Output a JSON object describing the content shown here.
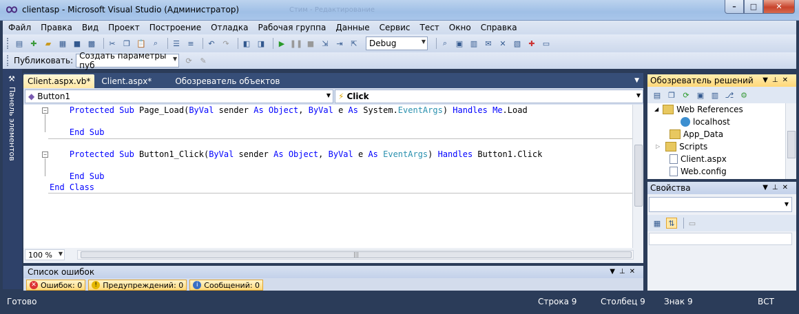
{
  "window": {
    "title": "clientasp - Microsoft Visual Studio (Администратор)",
    "ghost_title": "Стим - Редактирование",
    "min": "–",
    "max": "□",
    "close": "✕"
  },
  "menu": [
    "Файл",
    "Правка",
    "Вид",
    "Проект",
    "Построение",
    "Отладка",
    "Рабочая группа",
    "Данные",
    "Сервис",
    "Тест",
    "Окно",
    "Справка"
  ],
  "toolbar": {
    "config": "Debug",
    "publish_label": "Публиковать:",
    "publish_value": "Создать параметры пуб"
  },
  "left_strip": {
    "label": "Панель элементов"
  },
  "tabs": [
    {
      "label": "Client.aspx.vb*",
      "active": true
    },
    {
      "label": "Client.aspx*",
      "active": false
    },
    {
      "label": "Обозреватель объектов",
      "active": false
    }
  ],
  "nav": {
    "object": "Button1",
    "member": "Click"
  },
  "code": {
    "line1": {
      "pre": "    ",
      "k1": "Protected Sub",
      "n1": " Page_Load(",
      "k2": "ByVal",
      "n2": " sender ",
      "k3": "As",
      "n3": " ",
      "k4": "Object",
      "n4": ", ",
      "k5": "ByVal",
      "n5": " e ",
      "k6": "As",
      "n6": " System.",
      "t1": "EventArgs",
      "n7": ") ",
      "k7": "Handles",
      "n8": " ",
      "k8": "Me",
      "n9": ".Load"
    },
    "line2": "    End Sub",
    "line3": {
      "pre": "    ",
      "k1": "Protected Sub",
      "n1": " Button1_Click(",
      "k2": "ByVal",
      "n2": " sender ",
      "k3": "As",
      "n3": " ",
      "k4": "Object",
      "n4": ", ",
      "k5": "ByVal",
      "n5": " e ",
      "k6": "As",
      "n6": " ",
      "t1": "EventArgs",
      "n7": ") ",
      "k7": "Handles",
      "n8": " Button1.Click"
    },
    "line4": "    End Sub",
    "line5": "End Class"
  },
  "zoom": "100 %",
  "error_list": {
    "title": "Список ошибок",
    "errors": "Ошибок: 0",
    "warnings": "Предупреждений: 0",
    "messages": "Сообщений: 0"
  },
  "solution": {
    "title": "Обозреватель решений",
    "items": [
      "Web References",
      "localhost",
      "App_Data",
      "Scripts",
      "Client.aspx",
      "Web.config"
    ]
  },
  "properties": {
    "title": "Свойства"
  },
  "status": {
    "left": "Готово",
    "line": "Строка 9",
    "col": "Столбец 9",
    "char": "Знак 9",
    "mode": "ВСТ"
  }
}
